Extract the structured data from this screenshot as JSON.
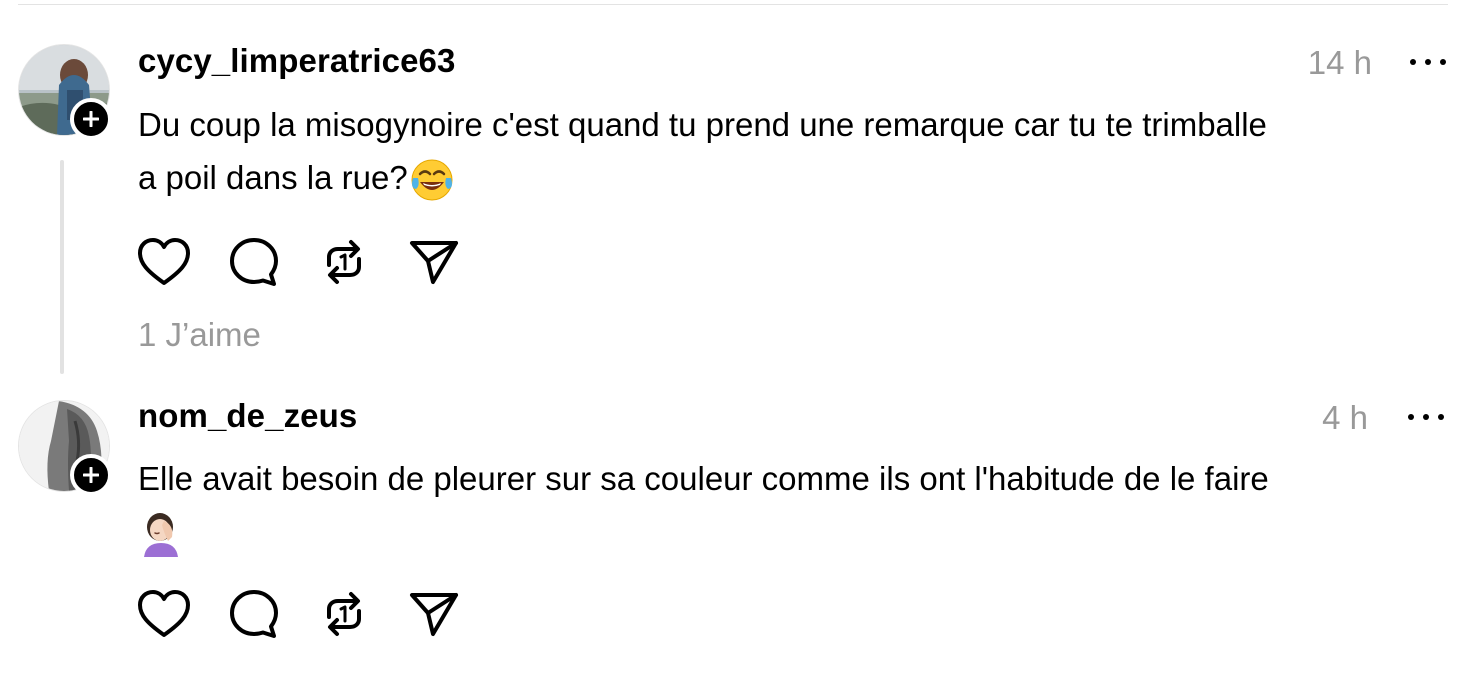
{
  "posts": [
    {
      "username": "cycy_limperatrice63",
      "time": "14 h",
      "text_line1": "Du coup la misogynoire c'est quand tu prend une remarque car tu te trimballe",
      "text_line2": "a poil dans la rue?",
      "emoji": "face-with-tears-of-joy-emoji",
      "likes": "1 J’aime"
    },
    {
      "username": "nom_de_zeus",
      "time": "4 h",
      "text_line1": "Elle avait besoin de pleurer sur sa couleur comme ils ont l'habitude de le faire",
      "emoji": "woman-facepalming-emoji"
    }
  ],
  "icons": {
    "like": "heart-icon",
    "reply": "comment-bubble-icon",
    "repost": "repost-icon",
    "share": "send-icon",
    "more": "more-horizontal-icon",
    "follow": "plus-icon"
  },
  "colors": {
    "text": "#000000",
    "muted": "#999999",
    "thread_line": "#e2e2e2",
    "background": "#ffffff"
  }
}
